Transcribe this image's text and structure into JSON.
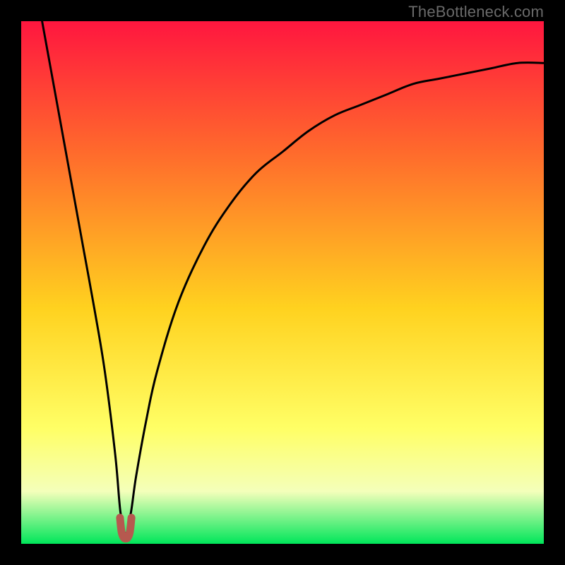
{
  "watermark": "TheBottleneck.com",
  "colors": {
    "frame_bg": "#000000",
    "gradient_top": "#ff163f",
    "gradient_mid_upper": "#ff6a2c",
    "gradient_mid": "#ffd21f",
    "gradient_mid_lower": "#ffff66",
    "gradient_pale": "#f4ffba",
    "gradient_bottom": "#00e65a",
    "curve_stroke": "#000000",
    "notch_stroke": "#b6594f"
  },
  "chart_data": {
    "type": "line",
    "title": "",
    "xlabel": "",
    "ylabel": "",
    "xlim": [
      0,
      100
    ],
    "ylim": [
      0,
      100
    ],
    "grid": false,
    "legend": false,
    "series": [
      {
        "name": "bottleneck-curve",
        "x": [
          4,
          6,
          8,
          10,
          12,
          14,
          16,
          18,
          19,
          20,
          21,
          22,
          24,
          26,
          30,
          35,
          40,
          45,
          50,
          55,
          60,
          65,
          70,
          75,
          80,
          85,
          90,
          95,
          100
        ],
        "y": [
          100,
          89,
          78,
          67,
          56,
          45,
          33,
          17,
          6,
          2,
          6,
          13,
          24,
          33,
          46,
          57,
          65,
          71,
          75,
          79,
          82,
          84,
          86,
          88,
          89,
          90,
          91,
          92,
          92
        ]
      },
      {
        "name": "optimal-notch",
        "x": [
          18.9,
          19.2,
          19.6,
          20.0,
          20.4,
          20.8,
          21.1
        ],
        "y": [
          5.0,
          2.3,
          1.2,
          1.0,
          1.2,
          2.3,
          5.0
        ]
      }
    ],
    "gradient_stops": [
      {
        "pos": 0.0,
        "color": "#ff163f"
      },
      {
        "pos": 0.25,
        "color": "#ff6a2c"
      },
      {
        "pos": 0.55,
        "color": "#ffd21f"
      },
      {
        "pos": 0.78,
        "color": "#ffff66"
      },
      {
        "pos": 0.9,
        "color": "#f4ffba"
      },
      {
        "pos": 1.0,
        "color": "#00e65a"
      }
    ]
  }
}
